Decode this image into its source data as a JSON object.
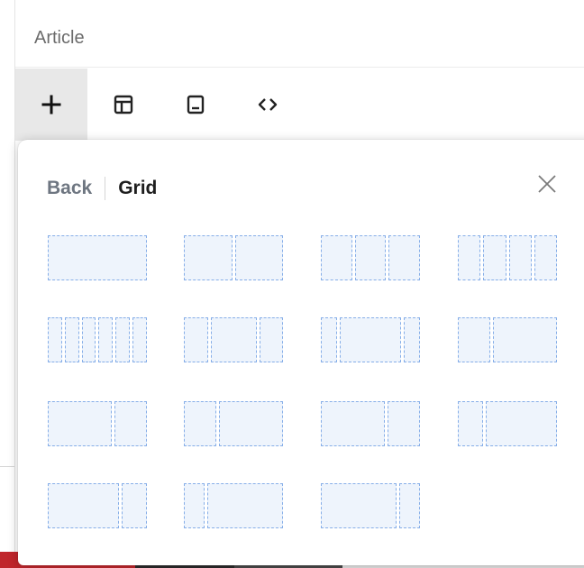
{
  "editor": {
    "title": "Article",
    "toolbar": [
      {
        "name": "add-button",
        "icon": "plus-icon",
        "active": true
      },
      {
        "name": "layout-button",
        "icon": "layout-icon"
      },
      {
        "name": "block-button",
        "icon": "square-block-icon"
      },
      {
        "name": "code-button",
        "icon": "code-icon"
      }
    ]
  },
  "panel": {
    "back_label": "Back",
    "title": "Grid",
    "close_icon": "close-icon"
  },
  "grid_options": [
    {
      "name": "grid-option-1-col",
      "cols": [
        1
      ]
    },
    {
      "name": "grid-option-2-col",
      "cols": [
        1,
        1
      ]
    },
    {
      "name": "grid-option-3-col",
      "cols": [
        1,
        1,
        1
      ]
    },
    {
      "name": "grid-option-4-col",
      "cols": [
        1,
        1,
        1,
        1
      ]
    },
    {
      "name": "grid-option-6-col",
      "cols": [
        1,
        1,
        1,
        1,
        1,
        1
      ]
    },
    {
      "name": "grid-option-1-2-1",
      "cols": [
        1,
        2,
        1
      ]
    },
    {
      "name": "grid-option-1-4-1",
      "cols": [
        1,
        4,
        1
      ]
    },
    {
      "name": "grid-option-1-2",
      "cols": [
        1,
        2
      ]
    },
    {
      "name": "grid-option-2-1",
      "cols": [
        2,
        1
      ]
    },
    {
      "name": "grid-option-1-2-b",
      "cols": [
        1,
        2
      ]
    },
    {
      "name": "grid-option-2-1-b",
      "cols": [
        2,
        1
      ]
    },
    {
      "name": "grid-option-1-3",
      "cols": [
        1,
        3
      ]
    },
    {
      "name": "grid-option-3-1",
      "cols": [
        3,
        1
      ]
    },
    {
      "name": "grid-option-1-4",
      "cols": [
        1,
        4
      ]
    },
    {
      "name": "grid-option-4-1",
      "cols": [
        4,
        1
      ]
    }
  ],
  "colors": {
    "cell_fill": "#eef4fc",
    "cell_border": "#86aee8",
    "active_tool": "#e8e8e8"
  }
}
